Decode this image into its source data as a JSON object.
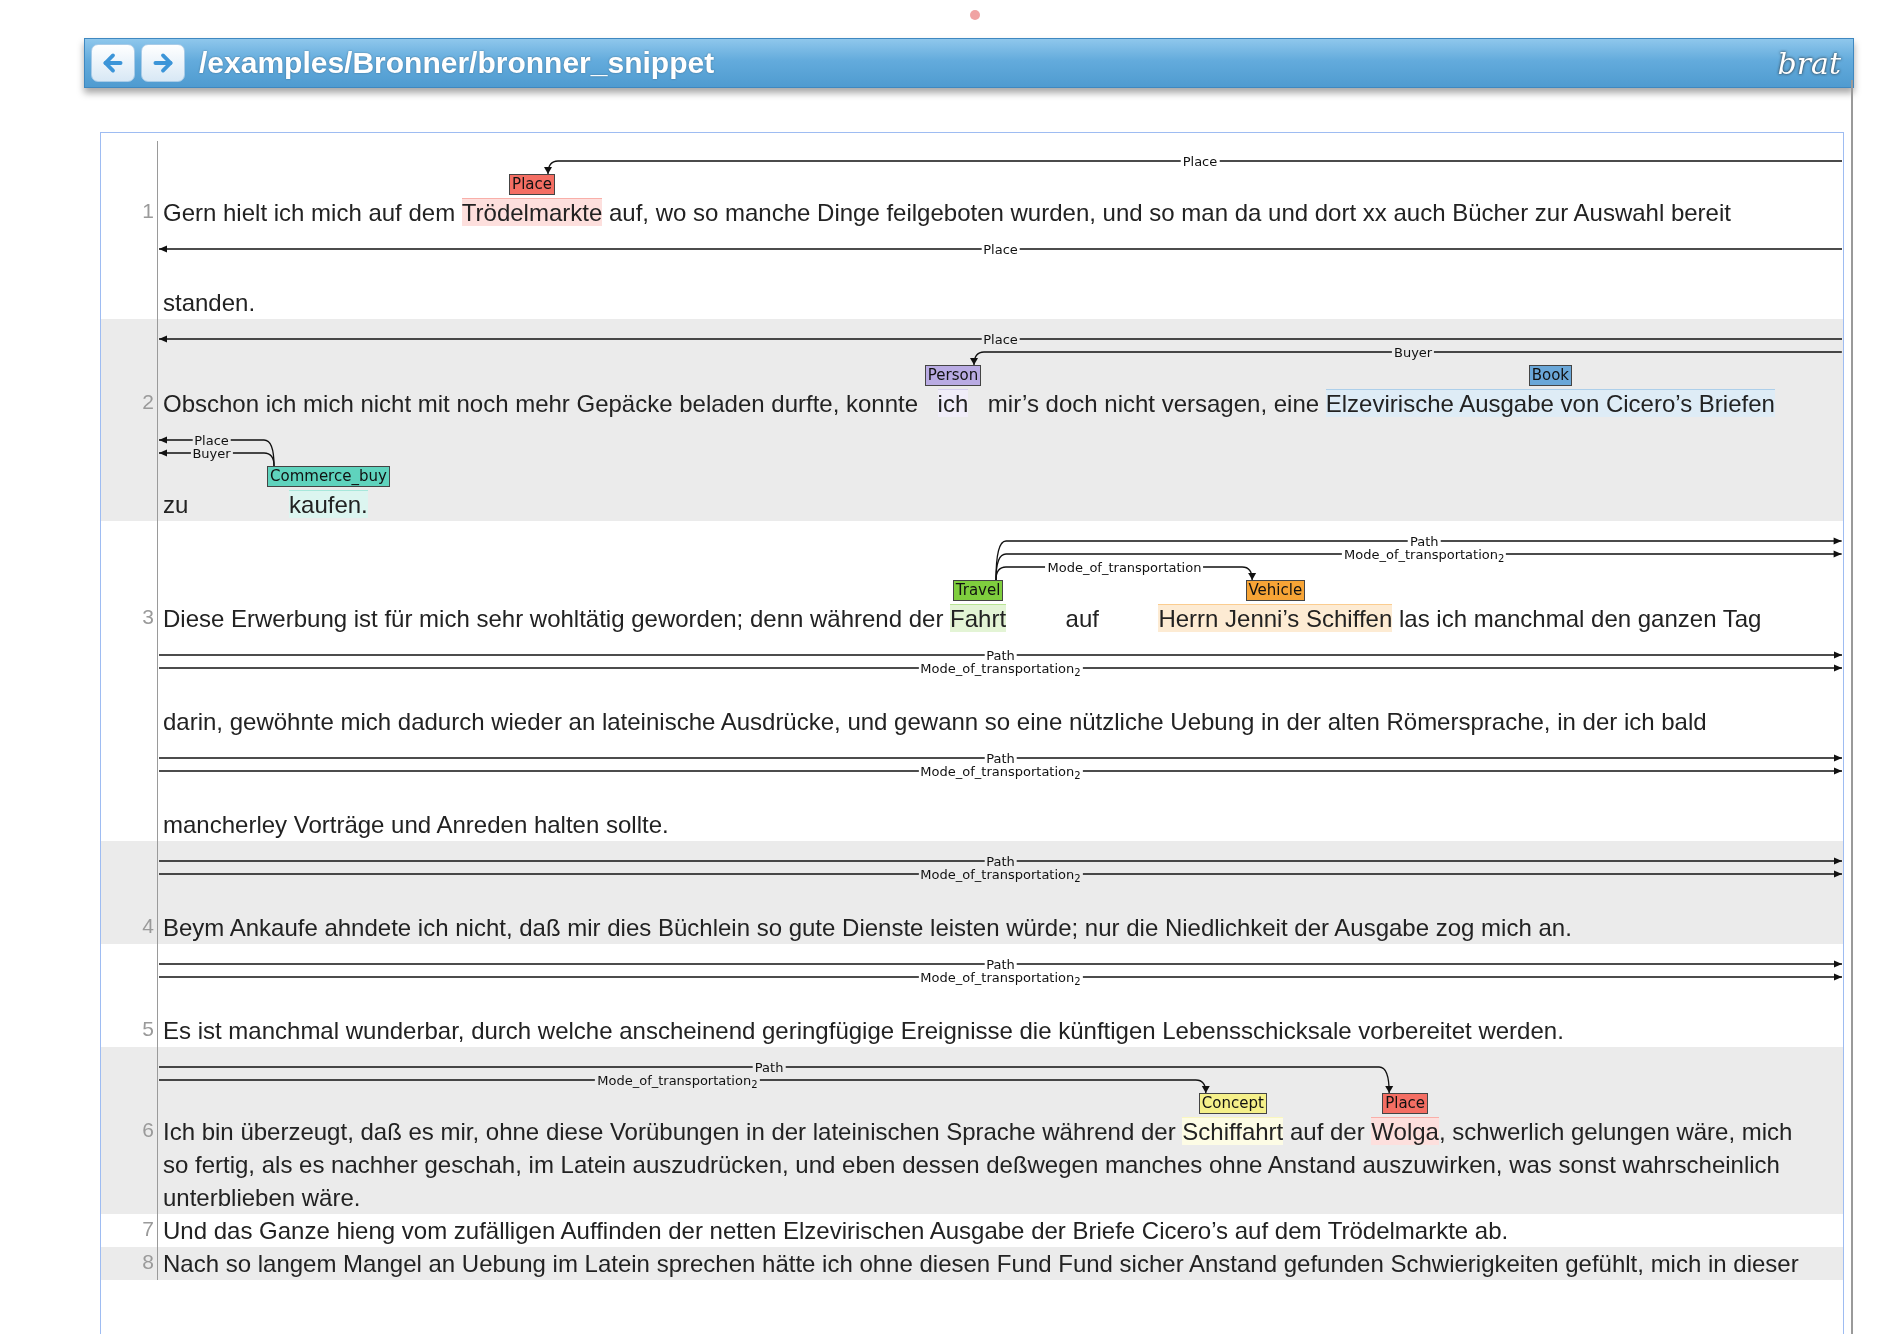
{
  "header": {
    "buttons": [
      {
        "kind": "back"
      },
      {
        "kind": "forward"
      }
    ],
    "title": "/examples/Bronner/bronner_snippet",
    "logo": "brat"
  },
  "sentences": [
    {
      "number": "1",
      "lines": [
        {
          "segments": [
            {
              "text": "Gern hielt ich mich auf dem "
            },
            {
              "text": "Trödelmarkte",
              "label": "Place",
              "color": "#f46e63"
            },
            {
              "text": " auf, wo so manche Dinge feilgeboten wurden, und so man da und dort xx auch Bücher zur Auswahl bereit"
            }
          ],
          "arcs": [
            {
              "label": "Place",
              "from": {
                "kind": "right"
              },
              "to": {
                "kind": "first"
              }
            }
          ]
        },
        {
          "segments": [
            {
              "text": "standen."
            }
          ],
          "arcs": [
            {
              "label": "Place",
              "from": {
                "kind": "right"
              },
              "to": {
                "kind": "left"
              }
            }
          ]
        }
      ]
    },
    {
      "number": "2",
      "lines": [
        {
          "segments": [
            {
              "text": "Obschon ich mich nicht mit noch mehr Gepäcke beladen durfte, konnte "
            },
            {
              "text": "ich",
              "label": "Person",
              "color": "#b9abe3"
            },
            {
              "text": " mir’s doch nicht versagen, eine "
            },
            {
              "text": "Elzevirische Ausgabe von Cicero’s Briefen",
              "label": "Book",
              "color": "#6aa7d8"
            }
          ],
          "arcs": [
            {
              "label": "Place",
              "from": {
                "kind": "right"
              },
              "to": {
                "kind": "left"
              }
            },
            {
              "label": "Buyer",
              "from": {
                "kind": "right"
              },
              "to": {
                "kind": "first"
              }
            }
          ]
        },
        {
          "segments": [
            {
              "text": "zu "
            },
            {
              "text": "kaufen.",
              "label": "Commerce_buy",
              "color": "#5fd3bd"
            }
          ],
          "arcs": [
            {
              "label": "Place",
              "from": {
                "kind": "first"
              },
              "to": {
                "kind": "left"
              }
            },
            {
              "label": "Buyer",
              "from": {
                "kind": "first"
              },
              "to": {
                "kind": "left"
              }
            }
          ]
        }
      ]
    },
    {
      "number": "3",
      "lines": [
        {
          "segments": [
            {
              "text": "Diese Erwerbung ist für mich sehr wohltätig geworden; denn während der "
            },
            {
              "text": "Fahrt",
              "label": "Travel",
              "color": "#7fce3e"
            },
            {
              "text": " auf "
            },
            {
              "text": "Herrn Jenni’s Schiffen",
              "label": "Vehicle",
              "color": "#f7a436"
            },
            {
              "text": " las ich manchmal den ganzen Tag"
            }
          ],
          "arcs": [
            {
              "label": "Path",
              "from": {
                "kind": "first"
              },
              "to": {
                "kind": "right"
              }
            },
            {
              "label": "Mode_of_transportation$_{2}$",
              "from": {
                "kind": "first"
              },
              "to": {
                "kind": "right"
              }
            },
            {
              "label": "Mode_of_transportation",
              "from": {
                "kind": "first"
              },
              "to": {
                "kind": "second"
              }
            }
          ]
        },
        {
          "segments": [
            {
              "text": "darin, gewöhnte mich dadurch wieder an lateinische Ausdrücke, und gewann so eine nützliche Uebung in der alten Römersprache, in der ich bald"
            }
          ],
          "arcs": [
            {
              "label": "Path",
              "from": {
                "kind": "left"
              },
              "to": {
                "kind": "right"
              }
            },
            {
              "label": "Mode_of_transportation$_{2}$",
              "from": {
                "kind": "left"
              },
              "to": {
                "kind": "right"
              }
            }
          ]
        },
        {
          "segments": [
            {
              "text": "mancherley Vorträge und Anreden halten sollte."
            }
          ],
          "arcs": [
            {
              "label": "Path",
              "from": {
                "kind": "left"
              },
              "to": {
                "kind": "right"
              }
            },
            {
              "label": "Mode_of_transportation$_{2}$",
              "from": {
                "kind": "left"
              },
              "to": {
                "kind": "right"
              }
            }
          ]
        }
      ]
    },
    {
      "number": "4",
      "lines": [
        {
          "segments": [
            {
              "text": "Beym Ankaufe ahndete ich nicht, daß mir dies Büchlein so gute Dienste leisten würde; nur die Niedlichkeit der Ausgabe zog mich an."
            }
          ],
          "arcs": [
            {
              "label": "Path",
              "from": {
                "kind": "left"
              },
              "to": {
                "kind": "right"
              }
            },
            {
              "label": "Mode_of_transportation$_{2}$",
              "from": {
                "kind": "left"
              },
              "to": {
                "kind": "right"
              }
            }
          ]
        }
      ]
    },
    {
      "number": "5",
      "lines": [
        {
          "segments": [
            {
              "text": "Es ist manchmal wunderbar, durch welche anscheinend geringfügige Ereignisse die künftigen Lebensschicksale vorbereitet werden."
            }
          ],
          "arcs": [
            {
              "label": "Path",
              "from": {
                "kind": "left"
              },
              "to": {
                "kind": "right"
              }
            },
            {
              "label": "Mode_of_transportation$_{2}$",
              "from": {
                "kind": "left"
              },
              "to": {
                "kind": "right"
              }
            }
          ]
        }
      ]
    },
    {
      "number": "6",
      "lines": [
        {
          "segments": [
            {
              "text": "Ich bin überzeugt, daß es mir, ohne diese Vorübungen in der lateinischen Sprache während der "
            },
            {
              "text": "Schiffahrt",
              "label": "Concept",
              "color": "#f5f08a"
            },
            {
              "text": " auf der "
            },
            {
              "text": "Wolga",
              "label": "Place",
              "color": "#f46e63"
            },
            {
              "text": ", schwerlich gelungen wäre, mich"
            }
          ],
          "arcs": [
            {
              "label": "Path",
              "from": {
                "kind": "left"
              },
              "to": {
                "kind": "second"
              }
            },
            {
              "label": "Mode_of_transportation$_{2}$",
              "from": {
                "kind": "left"
              },
              "to": {
                "kind": "first"
              }
            }
          ]
        },
        {
          "segments": [
            {
              "text": "so fertig, als es nachher geschah, im Latein auszudrücken, und eben dessen deßwegen manches ohne Anstand auszuwirken, was sonst wahrscheinlich"
            }
          ]
        },
        {
          "segments": [
            {
              "text": "unterblieben wäre."
            }
          ]
        }
      ]
    },
    {
      "number": "7",
      "lines": [
        {
          "segments": [
            {
              "text": "Und das Ganze hieng vom zufälligen Auffinden der netten Elzevirischen Ausgabe der Briefe Cicero’s auf dem Trödelmarkte ab."
            }
          ]
        }
      ]
    },
    {
      "number": "8",
      "lines": [
        {
          "segments": [
            {
              "text": "Nach so langem Mangel an Uebung im Latein sprechen hätte ich ohne diesen Fund Fund sicher Anstand gefunden Schwierigkeiten gefühlt, mich in dieser"
            }
          ]
        }
      ]
    }
  ]
}
